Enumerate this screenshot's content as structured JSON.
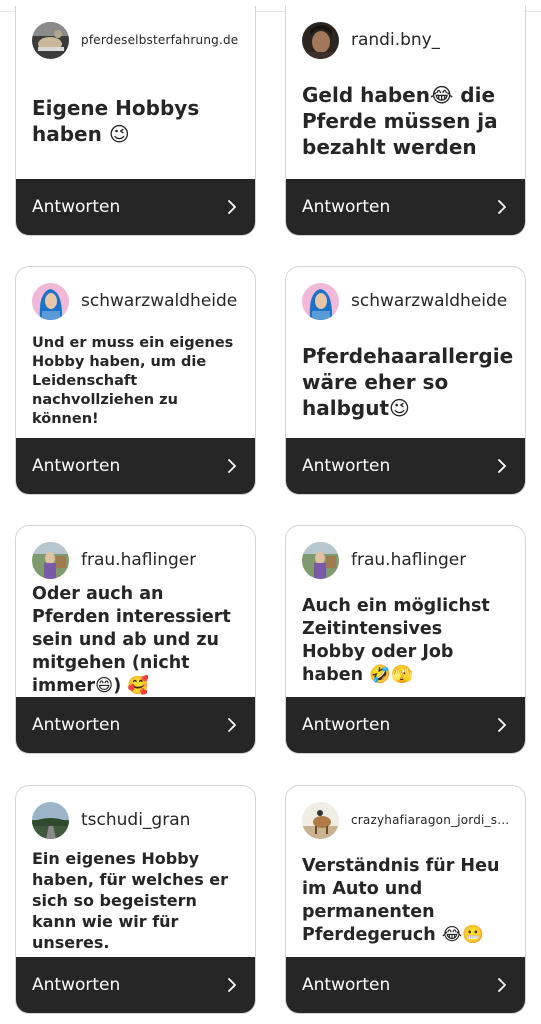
{
  "cards": [
    {
      "username": "pferdeselbsterfahrung.de",
      "answer": "Eigene Hobbys haben 😉",
      "action_label": "Antworten",
      "avatar_icon": "user-avatar-photo"
    },
    {
      "username": "randi.bny_",
      "answer": "Geld haben😂 die Pferde müssen ja bezahlt werden",
      "action_label": "Antworten",
      "avatar_icon": "user-avatar-photo"
    },
    {
      "username": "schwarzwaldheide",
      "answer": "Und er muss ein eigenes Hobby haben, um die Leidenschaft nachvollziehen zu können!",
      "action_label": "Antworten",
      "avatar_icon": "user-avatar-photo"
    },
    {
      "username": "schwarzwaldheide",
      "answer": "Pferdehaarallergie wäre eher so halbgut😉",
      "action_label": "Antworten",
      "avatar_icon": "user-avatar-photo"
    },
    {
      "username": "frau.haflinger",
      "answer": "Oder auch an Pferden interessiert sein und ab und zu mitgehen (nicht immer😄) 🥰",
      "action_label": "Antworten",
      "avatar_icon": "user-avatar-photo"
    },
    {
      "username": "frau.haflinger",
      "answer": "Auch ein möglichst Zeitintensives Hobby oder Job haben 🤣🫣",
      "action_label": "Antworten",
      "avatar_icon": "user-avatar-photo"
    },
    {
      "username": "tschudi_gran",
      "answer": "Ein eigenes Hobby haben, für welches er sich so begeistern kann wie wir für unseres.",
      "action_label": "Antworten",
      "avatar_icon": "user-avatar-photo"
    },
    {
      "username": "crazyhafiaragon_jordi_s...",
      "answer": "Verständnis für Heu im Auto und permanenten Pferdegeruch 😂😬",
      "action_label": "Antworten",
      "avatar_icon": "user-avatar-photo"
    }
  ],
  "colors": {
    "footer_bg": "#262626",
    "footer_text": "#ffffff",
    "card_border": "#d4d4d4",
    "text": "#262626"
  }
}
